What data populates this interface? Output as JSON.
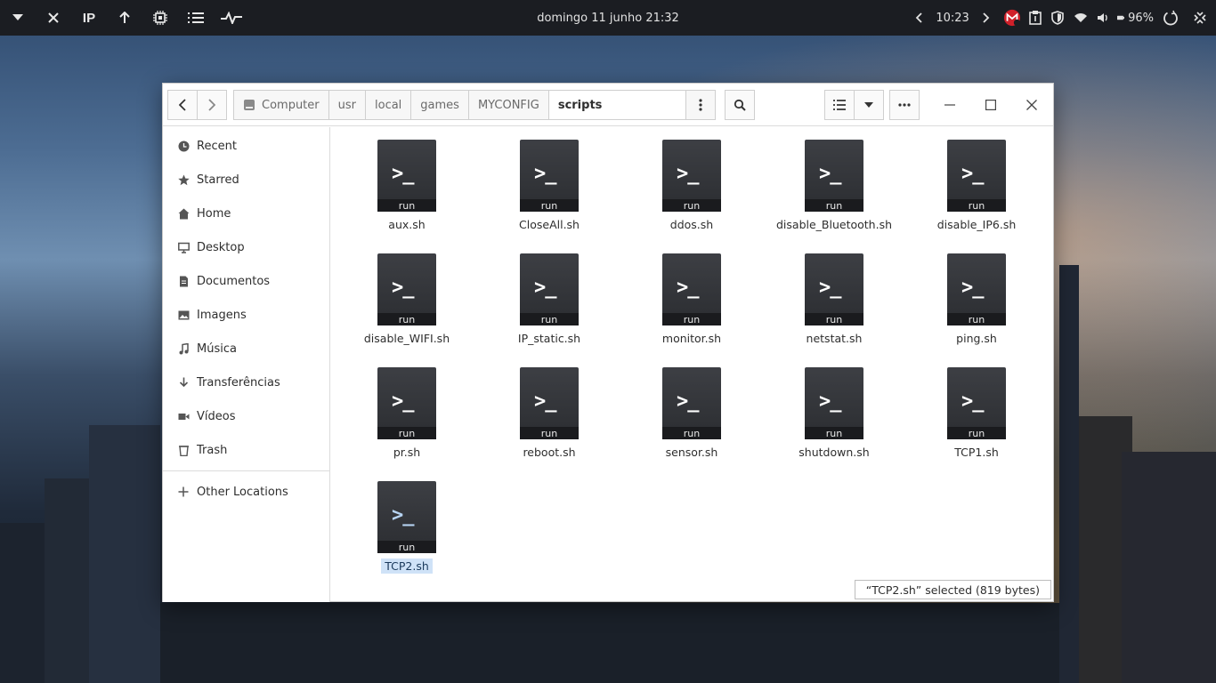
{
  "topbar": {
    "left_icons": [
      "chevron-down-icon",
      "close-icon",
      "ip-indicator",
      "arrow-up-icon",
      "cpu-icon",
      "list-icon",
      "pulse-icon"
    ],
    "ip_label": "IP",
    "datetime": "domingo 11 junho  21:32",
    "timer": "10:23",
    "battery": "96%"
  },
  "window": {
    "breadcrumbs": [
      "Computer",
      "usr",
      "local",
      "games",
      "MYCONFIG",
      "scripts"
    ],
    "sidebar": [
      {
        "label": "Recent",
        "icon": "clock-icon"
      },
      {
        "label": "Starred",
        "icon": "star-icon"
      },
      {
        "label": "Home",
        "icon": "home-icon"
      },
      {
        "label": "Desktop",
        "icon": "desktop-icon"
      },
      {
        "label": "Documentos",
        "icon": "document-icon"
      },
      {
        "label": "Imagens",
        "icon": "image-icon"
      },
      {
        "label": "Música",
        "icon": "music-icon"
      },
      {
        "label": "Transferências",
        "icon": "download-icon"
      },
      {
        "label": "Vídeos",
        "icon": "video-icon"
      },
      {
        "label": "Trash",
        "icon": "trash-icon"
      }
    ],
    "other_locations": "Other Locations",
    "file_badge": "run",
    "files": [
      "aux.sh",
      "CloseAll.sh",
      "ddos.sh",
      "disable_Bluetooth.sh",
      "disable_IP6.sh",
      "disable_WIFI.sh",
      "IP_static.sh",
      "monitor.sh",
      "netstat.sh",
      "ping.sh",
      "pr.sh",
      "reboot.sh",
      "sensor.sh",
      "shutdown.sh",
      "TCP1.sh",
      "TCP2.sh"
    ],
    "selected_file": "TCP2.sh",
    "status": "“TCP2.sh” selected  (819 bytes)"
  }
}
